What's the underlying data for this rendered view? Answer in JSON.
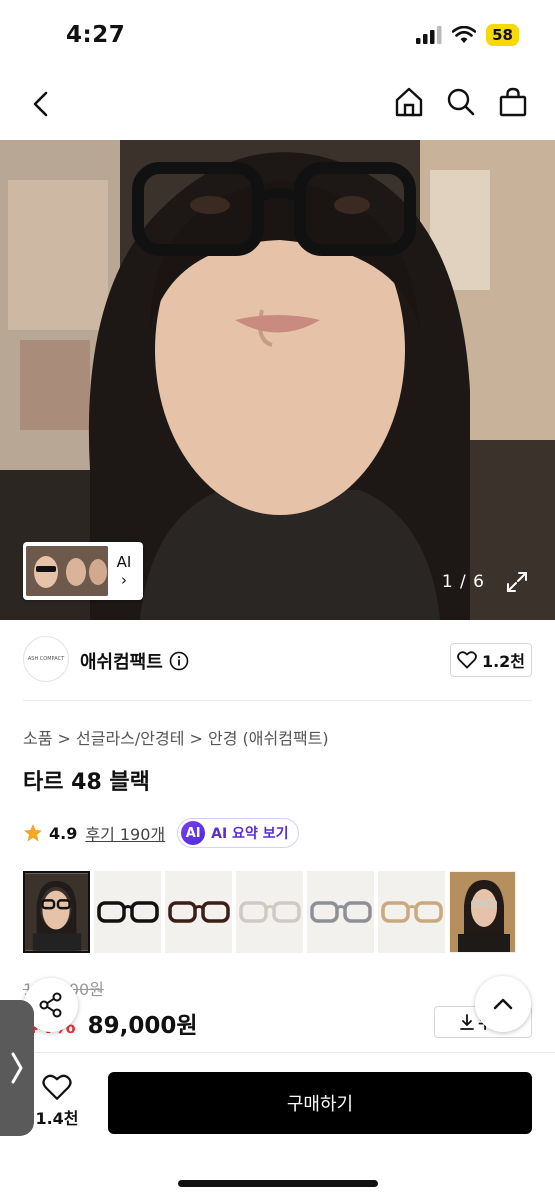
{
  "status": {
    "time": "4:27",
    "battery": "58"
  },
  "hero": {
    "ai_label": "AI",
    "ai_arrow": "›",
    "counter": "1 / 6"
  },
  "store": {
    "name": "애쉬컴팩트",
    "likes": "1.2천",
    "logo_text": "ASH COMPACT"
  },
  "breadcrumb": "소품 > 선글라스/안경테 > 안경 (애쉬컴팩트)",
  "product": {
    "title": "타르 48 블랙"
  },
  "rating": {
    "score": "4.9",
    "reviews": "후기 190개",
    "ai_summary": "AI 요약 보기",
    "ai_badge": "AI"
  },
  "price": {
    "original": "158,000원",
    "discount": "44%",
    "current": "89,000원",
    "coupon": "쿠폰"
  },
  "bottom": {
    "wish_count": "1.4천",
    "buy_label": "구매하기"
  },
  "colors": {
    "accent_red": "#e5333b",
    "ai_purple": "#5a2bd8",
    "battery": "#f5d90a",
    "star": "#f5a623"
  },
  "icons": [
    "back-icon",
    "home-icon",
    "search-icon",
    "bag-icon",
    "expand-icon",
    "info-icon",
    "heart-icon",
    "star-icon",
    "share-icon",
    "chevron-up-icon",
    "download-icon"
  ]
}
